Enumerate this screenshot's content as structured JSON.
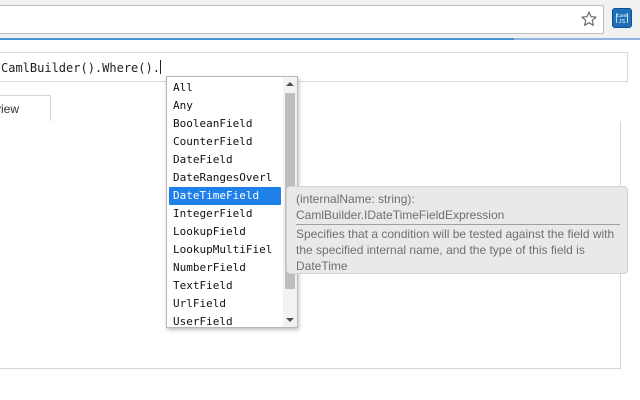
{
  "browser": {
    "address_value": "",
    "star_icon": "star-outline-icon",
    "extension": {
      "icon": "caml-js-extension-icon",
      "label_top": "Caml",
      "label_bottom": "JS"
    }
  },
  "editor": {
    "code": "CamlBuilder().Where()."
  },
  "tabs": [
    {
      "label": "view"
    }
  ],
  "autocomplete": {
    "items": [
      "All",
      "Any",
      "BooleanField",
      "CounterField",
      "DateField",
      "DateRangesOverl",
      "DateTimeField",
      "IntegerField",
      "LookupField",
      "LookupMultiFiel",
      "NumberField",
      "TextField",
      "UrlField",
      "UserField"
    ],
    "selected_index": 6
  },
  "tooltip": {
    "signature": "(internalName: string):",
    "return_type": "CamlBuilder.IDateTimeFieldExpression",
    "description_lines": [
      "Specifies that a condition will be tested against the field with",
      "the specified internal name, and the type of this field is",
      "DateTime"
    ]
  },
  "colors": {
    "selection": "#1e80e8",
    "extension_bg": "#1e6fb8",
    "progress": "#4a90d9"
  }
}
